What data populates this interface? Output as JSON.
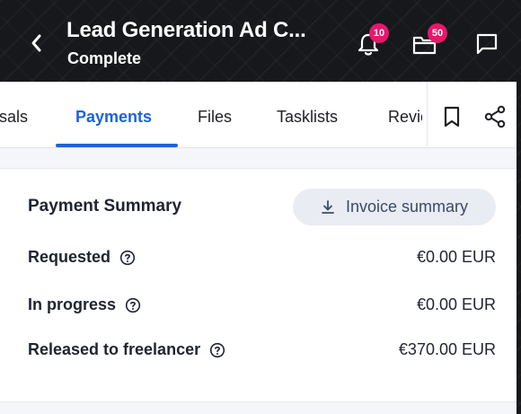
{
  "header": {
    "title": "Lead Generation Ad C...",
    "status": "Complete",
    "notifications_count": "10",
    "folder_count": "50"
  },
  "tabs": [
    {
      "label": "sals"
    },
    {
      "label": "Payments"
    },
    {
      "label": "Files"
    },
    {
      "label": "Tasklists"
    },
    {
      "label": "Revie"
    }
  ],
  "summary": {
    "title": "Payment Summary",
    "invoice_button": "Invoice summary",
    "rows": [
      {
        "label": "Requested",
        "value": "€0.00 EUR"
      },
      {
        "label": "In progress",
        "value": "€0.00 EUR"
      },
      {
        "label": "Released to freelancer",
        "value": "€370.00 EUR"
      }
    ]
  },
  "colors": {
    "accent": "#1e63d8",
    "badge": "#e8176b",
    "header_bg": "#17181c"
  }
}
